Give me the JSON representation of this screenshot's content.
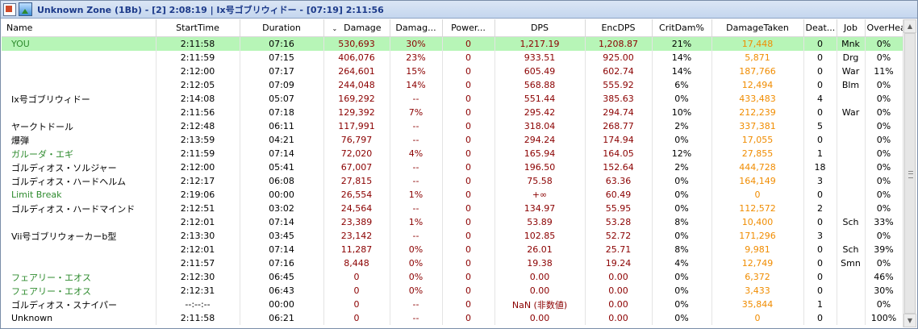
{
  "window": {
    "title": "Unknown Zone (1Bb) - [2] 2:08:19 | Ix号ゴブリウィドー - [07:19] 2:11:56"
  },
  "columns": [
    "Name",
    "StartTime",
    "Duration",
    "Damage",
    "Damag...",
    "Power...",
    "DPS",
    "EncDPS",
    "CritDam%",
    "DamageTaken",
    "Deat...",
    "Job",
    "OverHealPct"
  ],
  "sort_column": "Damage",
  "colors": {
    "highlight_row": "#b7f5b7",
    "damage": "#8b0000",
    "taken": "#f08c00",
    "pet_name": "#2e8b2e",
    "title": "#1c3a8a"
  },
  "rows": [
    {
      "name": "YOU",
      "start": "2:11:58",
      "duration": "07:16",
      "damage": "530,693",
      "damagePct": "30%",
      "power": "0",
      "dps": "1,217.19",
      "encdps": "1,208.87",
      "crit": "21%",
      "taken": "17,448",
      "deaths": "0",
      "job": "Mnk",
      "overheal": "0%",
      "nameColor": "green",
      "highlight": true
    },
    {
      "name": "",
      "start": "2:11:59",
      "duration": "07:15",
      "damage": "406,076",
      "damagePct": "23%",
      "power": "0",
      "dps": "933.51",
      "encdps": "925.00",
      "crit": "14%",
      "taken": "5,871",
      "deaths": "0",
      "job": "Drg",
      "overheal": "0%"
    },
    {
      "name": "",
      "start": "2:12:00",
      "duration": "07:17",
      "damage": "264,601",
      "damagePct": "15%",
      "power": "0",
      "dps": "605.49",
      "encdps": "602.74",
      "crit": "14%",
      "taken": "187,766",
      "deaths": "0",
      "job": "War",
      "overheal": "11%"
    },
    {
      "name": "",
      "start": "2:12:05",
      "duration": "07:09",
      "damage": "244,048",
      "damagePct": "14%",
      "power": "0",
      "dps": "568.88",
      "encdps": "555.92",
      "crit": "6%",
      "taken": "12,494",
      "deaths": "0",
      "job": "Blm",
      "overheal": "0%"
    },
    {
      "name": "Ix号ゴブリウィドー",
      "start": "2:14:08",
      "duration": "05:07",
      "damage": "169,292",
      "damagePct": "--",
      "power": "0",
      "dps": "551.44",
      "encdps": "385.63",
      "crit": "0%",
      "taken": "433,483",
      "deaths": "4",
      "job": "",
      "overheal": "0%"
    },
    {
      "name": "",
      "start": "2:11:56",
      "duration": "07:18",
      "damage": "129,392",
      "damagePct": "7%",
      "power": "0",
      "dps": "295.42",
      "encdps": "294.74",
      "crit": "10%",
      "taken": "212,239",
      "deaths": "0",
      "job": "War",
      "overheal": "0%"
    },
    {
      "name": "ヤークトドール",
      "start": "2:12:48",
      "duration": "06:11",
      "damage": "117,991",
      "damagePct": "--",
      "power": "0",
      "dps": "318.04",
      "encdps": "268.77",
      "crit": "2%",
      "taken": "337,381",
      "deaths": "5",
      "job": "",
      "overheal": "0%"
    },
    {
      "name": "爆弾",
      "start": "2:13:59",
      "duration": "04:21",
      "damage": "76,797",
      "damagePct": "--",
      "power": "0",
      "dps": "294.24",
      "encdps": "174.94",
      "crit": "0%",
      "taken": "17,055",
      "deaths": "0",
      "job": "",
      "overheal": "0%"
    },
    {
      "name": "ガルーダ・エギ",
      "start": "2:11:59",
      "duration": "07:14",
      "damage": "72,020",
      "damagePct": "4%",
      "power": "0",
      "dps": "165.94",
      "encdps": "164.05",
      "crit": "12%",
      "taken": "27,855",
      "deaths": "1",
      "job": "",
      "overheal": "0%",
      "nameColor": "green"
    },
    {
      "name": "ゴルディオス・ソルジャー",
      "start": "2:12:00",
      "duration": "05:41",
      "damage": "67,007",
      "damagePct": "--",
      "power": "0",
      "dps": "196.50",
      "encdps": "152.64",
      "crit": "2%",
      "taken": "444,728",
      "deaths": "18",
      "job": "",
      "overheal": "0%"
    },
    {
      "name": "ゴルディオス・ハードヘルム",
      "start": "2:12:17",
      "duration": "06:08",
      "damage": "27,815",
      "damagePct": "--",
      "power": "0",
      "dps": "75.58",
      "encdps": "63.36",
      "crit": "0%",
      "taken": "164,149",
      "deaths": "3",
      "job": "",
      "overheal": "0%"
    },
    {
      "name": "Limit Break",
      "start": "2:19:06",
      "duration": "00:00",
      "damage": "26,554",
      "damagePct": "1%",
      "power": "0",
      "dps": "+∞",
      "encdps": "60.49",
      "crit": "0%",
      "taken": "0",
      "deaths": "0",
      "job": "",
      "overheal": "0%",
      "nameColor": "green"
    },
    {
      "name": "ゴルディオス・ハードマインド",
      "start": "2:12:51",
      "duration": "03:02",
      "damage": "24,564",
      "damagePct": "--",
      "power": "0",
      "dps": "134.97",
      "encdps": "55.95",
      "crit": "0%",
      "taken": "112,572",
      "deaths": "2",
      "job": "",
      "overheal": "0%"
    },
    {
      "name": "",
      "start": "2:12:01",
      "duration": "07:14",
      "damage": "23,389",
      "damagePct": "1%",
      "power": "0",
      "dps": "53.89",
      "encdps": "53.28",
      "crit": "8%",
      "taken": "10,400",
      "deaths": "0",
      "job": "Sch",
      "overheal": "33%"
    },
    {
      "name": "Vii号ゴブリウォーカーb型",
      "start": "2:13:30",
      "duration": "03:45",
      "damage": "23,142",
      "damagePct": "--",
      "power": "0",
      "dps": "102.85",
      "encdps": "52.72",
      "crit": "0%",
      "taken": "171,296",
      "deaths": "3",
      "job": "",
      "overheal": "0%"
    },
    {
      "name": "",
      "start": "2:12:01",
      "duration": "07:14",
      "damage": "11,287",
      "damagePct": "0%",
      "power": "0",
      "dps": "26.01",
      "encdps": "25.71",
      "crit": "8%",
      "taken": "9,981",
      "deaths": "0",
      "job": "Sch",
      "overheal": "39%"
    },
    {
      "name": "",
      "start": "2:11:57",
      "duration": "07:16",
      "damage": "8,448",
      "damagePct": "0%",
      "power": "0",
      "dps": "19.38",
      "encdps": "19.24",
      "crit": "4%",
      "taken": "12,749",
      "deaths": "0",
      "job": "Smn",
      "overheal": "0%"
    },
    {
      "name": "フェアリー・エオス",
      "start": "2:12:30",
      "duration": "06:45",
      "damage": "0",
      "damagePct": "0%",
      "power": "0",
      "dps": "0.00",
      "encdps": "0.00",
      "crit": "0%",
      "taken": "6,372",
      "deaths": "0",
      "job": "",
      "overheal": "46%",
      "nameColor": "green"
    },
    {
      "name": "フェアリー・エオス",
      "start": "2:12:31",
      "duration": "06:43",
      "damage": "0",
      "damagePct": "0%",
      "power": "0",
      "dps": "0.00",
      "encdps": "0.00",
      "crit": "0%",
      "taken": "3,433",
      "deaths": "0",
      "job": "",
      "overheal": "30%",
      "nameColor": "green"
    },
    {
      "name": "ゴルディオス・スナイパー",
      "start": "--:--:--",
      "duration": "00:00",
      "damage": "0",
      "damagePct": "--",
      "power": "0",
      "dps": "NaN (非数値)",
      "encdps": "0.00",
      "crit": "0%",
      "taken": "35,844",
      "deaths": "1",
      "job": "",
      "overheal": "0%"
    },
    {
      "name": "Unknown",
      "start": "2:11:58",
      "duration": "06:21",
      "damage": "0",
      "damagePct": "--",
      "power": "0",
      "dps": "0.00",
      "encdps": "0.00",
      "crit": "0%",
      "taken": "0",
      "deaths": "0",
      "job": "",
      "overheal": "100%"
    }
  ]
}
